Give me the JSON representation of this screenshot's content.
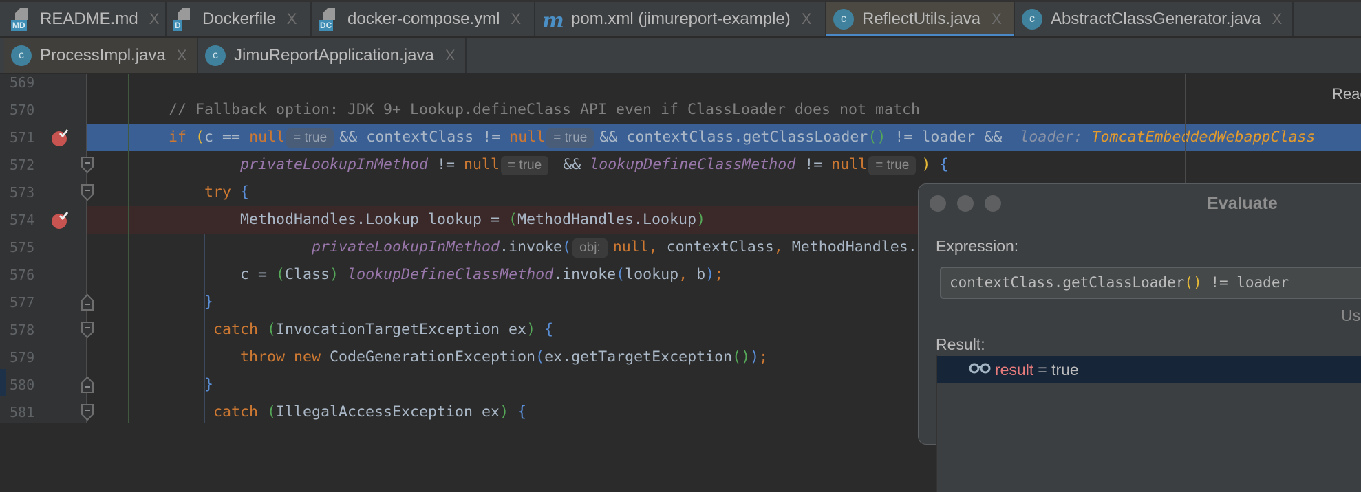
{
  "tabs_row1": [
    {
      "label": "README.md",
      "icon": "markdown-file-icon",
      "badge": "MD"
    },
    {
      "label": "Dockerfile",
      "icon": "docker-file-icon",
      "badge": "D"
    },
    {
      "label": "docker-compose.yml",
      "icon": "docker-compose-file-icon",
      "badge": "DC"
    },
    {
      "label": "pom.xml (jimureport-example)",
      "icon": "maven-icon",
      "badge": "m"
    },
    {
      "label": "ReflectUtils.java",
      "icon": "java-class-icon",
      "badge": "C",
      "active": true
    },
    {
      "label": "AbstractClassGenerator.java",
      "icon": "abstract-class-icon",
      "badge": "C"
    }
  ],
  "tabs_row2": [
    {
      "label": "ProcessImpl.java",
      "icon": "java-class-icon",
      "badge": "C"
    },
    {
      "label": "JimuReportApplication.java",
      "icon": "spring-boot-class-icon",
      "badge": "C"
    }
  ],
  "close_glyph": "X",
  "reader_mode": "Reac",
  "editor": {
    "lines": [
      {
        "n": "569",
        "tokens": []
      },
      {
        "n": "570",
        "tokens": [
          {
            "t": "        // Fallback option: JDK 9+ Lookup.defineClass API even if ClassLoader does not match",
            "c": "cm"
          }
        ]
      },
      {
        "n": "571",
        "hl": true,
        "bp": true,
        "tokens": [
          {
            "t": "        "
          },
          {
            "t": "if ",
            "c": "kw"
          },
          {
            "t": "(",
            "c": "p1"
          },
          {
            "t": "c == "
          },
          {
            "t": "null",
            "c": "kw"
          },
          {
            "h": "= true"
          },
          {
            "t": "&& contextClass != "
          },
          {
            "t": "null",
            "c": "kw"
          },
          {
            "h": "= true"
          },
          {
            "t": "&& contextClass.getClassLoader"
          },
          {
            "t": "()",
            "c": "p2"
          },
          {
            "t": " != loader &&  "
          },
          {
            "t": "loader: ",
            "c": "lh"
          },
          {
            "t": "TomcatEmbeddedWebappClass",
            "c": "lv"
          }
        ]
      },
      {
        "n": "572",
        "fold": "start",
        "tokens": [
          {
            "t": "                "
          },
          {
            "t": "privateLookupInMethod",
            "c": "pu"
          },
          {
            "t": " != "
          },
          {
            "t": "null",
            "c": "kw"
          },
          {
            "h": "= true"
          },
          {
            "t": " && "
          },
          {
            "t": "lookupDefineClassMethod",
            "c": "pu"
          },
          {
            "t": " != "
          },
          {
            "t": "null",
            "c": "kw"
          },
          {
            "h": "= true"
          },
          {
            "t": ")",
            "c": "p1"
          },
          {
            "t": " "
          },
          {
            "t": "{",
            "c": "p3"
          }
        ]
      },
      {
        "n": "573",
        "fold": "start",
        "tokens": [
          {
            "t": "            "
          },
          {
            "t": "try ",
            "c": "kw"
          },
          {
            "t": "{",
            "c": "p3"
          }
        ]
      },
      {
        "n": "574",
        "bp": true,
        "err": true,
        "tokens": [
          {
            "t": "                MethodHandles.Lookup lookup = "
          },
          {
            "t": "(",
            "c": "p2"
          },
          {
            "t": "MethodHandles.Lookup"
          },
          {
            "t": ")",
            "c": "p2"
          }
        ]
      },
      {
        "n": "575",
        "tokens": [
          {
            "t": "                        "
          },
          {
            "t": "privateLookupInMethod",
            "c": "pu"
          },
          {
            "t": ".invoke"
          },
          {
            "t": "(",
            "c": "p3"
          },
          {
            "h": "obj:"
          },
          {
            "t": "null",
            "c": "kw"
          },
          {
            "t": ", ",
            "c": "or"
          },
          {
            "t": "contextClass"
          },
          {
            "t": ", ",
            "c": "or"
          },
          {
            "t": "MethodHandles.lookup()"
          }
        ]
      },
      {
        "n": "576",
        "tokens": [
          {
            "t": "                c = "
          },
          {
            "t": "(",
            "c": "p2"
          },
          {
            "t": "Class"
          },
          {
            "t": ")",
            "c": "p2"
          },
          {
            "t": " "
          },
          {
            "t": "lookupDefineClassMethod",
            "c": "pu"
          },
          {
            "t": ".invoke"
          },
          {
            "t": "(",
            "c": "p3"
          },
          {
            "t": "lookup"
          },
          {
            "t": ", ",
            "c": "or"
          },
          {
            "t": "b"
          },
          {
            "t": ")",
            "c": "p3"
          },
          {
            "t": ";",
            "c": "or"
          }
        ]
      },
      {
        "n": "577",
        "fold": "end",
        "tokens": [
          {
            "t": "            "
          },
          {
            "t": "}",
            "c": "p3"
          }
        ]
      },
      {
        "n": "578",
        "fold": "start",
        "tokens": [
          {
            "t": "             "
          },
          {
            "t": "catch ",
            "c": "kw"
          },
          {
            "t": "(",
            "c": "p2"
          },
          {
            "t": "InvocationTargetException ex"
          },
          {
            "t": ")",
            "c": "p2"
          },
          {
            "t": " "
          },
          {
            "t": "{",
            "c": "p3"
          }
        ]
      },
      {
        "n": "579",
        "tokens": [
          {
            "t": "                "
          },
          {
            "t": "throw new ",
            "c": "kw"
          },
          {
            "t": "CodeGenerationException"
          },
          {
            "t": "(",
            "c": "p3"
          },
          {
            "t": "ex.getTargetException"
          },
          {
            "t": "()",
            "c": "p2"
          },
          {
            "t": ")",
            "c": "p3"
          },
          {
            "t": ";",
            "c": "or"
          }
        ]
      },
      {
        "n": "580",
        "fold": "end",
        "tokens": [
          {
            "t": "            "
          },
          {
            "t": "}",
            "c": "p3"
          }
        ]
      },
      {
        "n": "581",
        "fold": "start",
        "tokens": [
          {
            "t": "             "
          },
          {
            "t": "catch ",
            "c": "kw"
          },
          {
            "t": "(",
            "c": "p2"
          },
          {
            "t": "IllegalAccessException ex"
          },
          {
            "t": ")",
            "c": "p2"
          },
          {
            "t": " "
          },
          {
            "t": "{",
            "c": "p3"
          }
        ]
      }
    ]
  },
  "dialog": {
    "title": "Evaluate",
    "expression_label": "Expression:",
    "expression_value": "contextClass.getClassLoader() != loader",
    "use_hint": "Us",
    "result_label": "Result:",
    "result_name": "result",
    "result_value": "= true"
  }
}
